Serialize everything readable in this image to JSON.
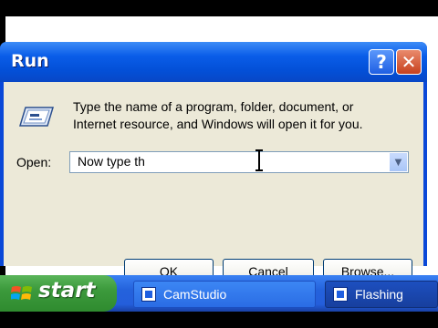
{
  "dialog": {
    "title": "Run",
    "help_label": "?",
    "close_label": "✕",
    "description_line1": "Type the name of a program, folder, document, or",
    "description_line2": "Internet resource, and Windows will open it for you.",
    "open_label": "Open:",
    "open_value": "Now type th",
    "dropdown_arrow": "▼",
    "buttons": {
      "ok": "OK",
      "cancel": "Cancel",
      "browse": "Browse..."
    }
  },
  "taskbar": {
    "start_label": "start",
    "items": [
      {
        "label": "CamStudio",
        "icon": "camstudio-icon"
      },
      {
        "label": "Flashing",
        "icon": "flashing-icon"
      }
    ]
  },
  "colors": {
    "title_blue": "#0350d8",
    "close_red": "#c7411f",
    "start_green": "#3c9a3c",
    "dialog_face": "#ece9d8"
  }
}
